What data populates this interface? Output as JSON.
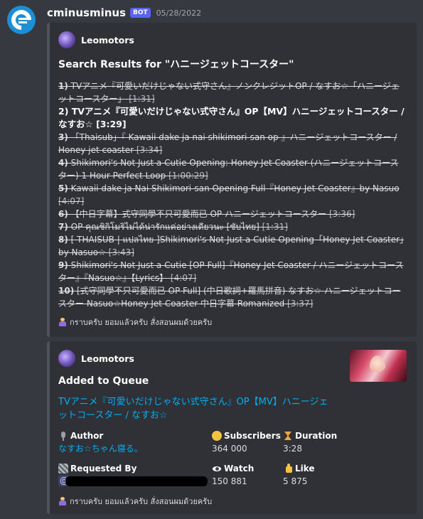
{
  "message": {
    "username": "cminusminus",
    "badge": "BOT",
    "timestamp": "05/28/2022"
  },
  "search_embed": {
    "author": "Leomotors",
    "title": "Search Results for \"ハニージェットコースター\"",
    "results": [
      {
        "num": "1)",
        "text": " TVアニメ『可愛いだけじゃない式守さん』ノンクレジットOP / なすお☆「ハニージェットコースター」",
        "duration": " [1:31]",
        "current": false
      },
      {
        "num": "2)",
        "text": " TVアニメ『可愛いだけじゃない式守さん』OP【MV】ハニージェットコースター / なすお☆",
        "duration": " [3:29]",
        "current": true
      },
      {
        "num": "3)",
        "text": " 「Thaisub」『 Kawaii dake ja nai shikimori-san op 』ハニージェットコースター / Honey jet coaster",
        "duration": " [3:34]",
        "current": false
      },
      {
        "num": "4)",
        "text": " Shikimori's Not Just a Cutie Opening: Honey Jet Coaster (ハニージェットコースター) 1 Hour Perfect Loop",
        "duration": " [1:00:29]",
        "current": false
      },
      {
        "num": "5)",
        "text": " Kawaii dake ja Nai Shikimori-san Opening Full『Honey Jet Coaster』by Nasuo",
        "duration": " [4:07]",
        "current": false
      },
      {
        "num": "6)",
        "text": " 【中日字幕】式守同學不只可愛而已 OP ハニージェットコースター",
        "duration": " [3:36]",
        "current": false
      },
      {
        "num": "7)",
        "text": " OP คุณชิกิโมริไม่ได้น่ารักแค่อย่างเดียวนะ [ซับไทย]",
        "duration": " [1:31]",
        "current": false
      },
      {
        "num": "8)",
        "text": " [ THAISUB | แปลไทย ]Shikimori's Not Just a Cutie Opening「Honey Jet Coaster」by Nasuo☆",
        "duration": " [3:43]",
        "current": false
      },
      {
        "num": "9)",
        "text": " Shikimori's Not Just a Cutie [OP Full]『Honey Jet Coaster / ハニージェットコースター』『Nasuo☆』【Lyrics】",
        "duration": " [4:07]",
        "current": false
      },
      {
        "num": "10)",
        "text": " [式守同學不只可愛而已 OP Full] (中日歌詞+羅馬拼音) なすお☆ ハニージェットコースター Nasuo☆Honey Jet Coaster 中日字幕 Romanized",
        "duration": " [3:37]",
        "current": false
      }
    ],
    "footer": "กราบครับ ยอมแล้วครับ สั่งสอนผมด้วยครับ"
  },
  "queue_embed": {
    "author": "Leomotors",
    "title": "Added to Queue",
    "track_title": "TVアニメ『可愛いだけじゃない式守さん』OP【MV】ハニージェットコースター / なすお☆",
    "fields": {
      "author_label": "Author",
      "author_value": "なすお☆ちゃん寝る。",
      "subscribers_label": "Subscribers",
      "subscribers_value": "364 000",
      "duration_label": "Duration",
      "duration_value": "3:28",
      "requested_label": "Requested By",
      "requested_value": "@",
      "watch_label": "Watch",
      "watch_value": "150 881",
      "like_label": "Like",
      "like_value": "5 875"
    },
    "footer": "กราบครับ ยอมแล้วครับ สั่งสอนผมด้วยครับ"
  },
  "icons": [
    "bot-avatar-icon",
    "author-avatar-icon",
    "pray-icon",
    "microphone-icon",
    "face-icon",
    "hourglass-icon",
    "film-icon",
    "eye-icon",
    "thumbs-up-icon"
  ],
  "colors": {
    "background": "#36393f",
    "embed": "#2f3136",
    "link": "#00aff4",
    "badge": "#5865f2"
  }
}
